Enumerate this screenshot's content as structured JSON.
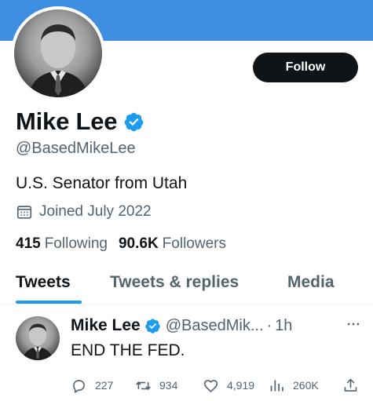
{
  "profile": {
    "display_name": "Mike Lee",
    "handle": "@BasedMikeLee",
    "bio": "U.S. Senator from Utah",
    "joined": "Joined July 2022",
    "following_count": "415",
    "following_label": "Following",
    "followers_count": "90.6K",
    "followers_label": "Followers",
    "follow_button_label": "Follow",
    "verified": true
  },
  "tabs": [
    {
      "label": "Tweets",
      "active": true
    },
    {
      "label": "Tweets & replies",
      "active": false
    },
    {
      "label": "Media",
      "active": false
    }
  ],
  "tweet": {
    "name": "Mike Lee",
    "handle": "@BasedMik...",
    "separator": "·",
    "time": "1h",
    "text": "END THE FED.",
    "replies": "227",
    "retweets": "934",
    "likes": "4,919",
    "views": "260K"
  },
  "colors": {
    "banner": "#3d8ee0",
    "verified": "#1d9bf0",
    "follow_button": "#0f1419",
    "muted_text": "#536471",
    "tab_indicator": "#1d9bf0"
  },
  "icons": [
    "verified-badge-icon",
    "calendar-icon",
    "more-icon",
    "reply-icon",
    "retweet-icon",
    "like-icon",
    "views-icon",
    "share-icon"
  ]
}
